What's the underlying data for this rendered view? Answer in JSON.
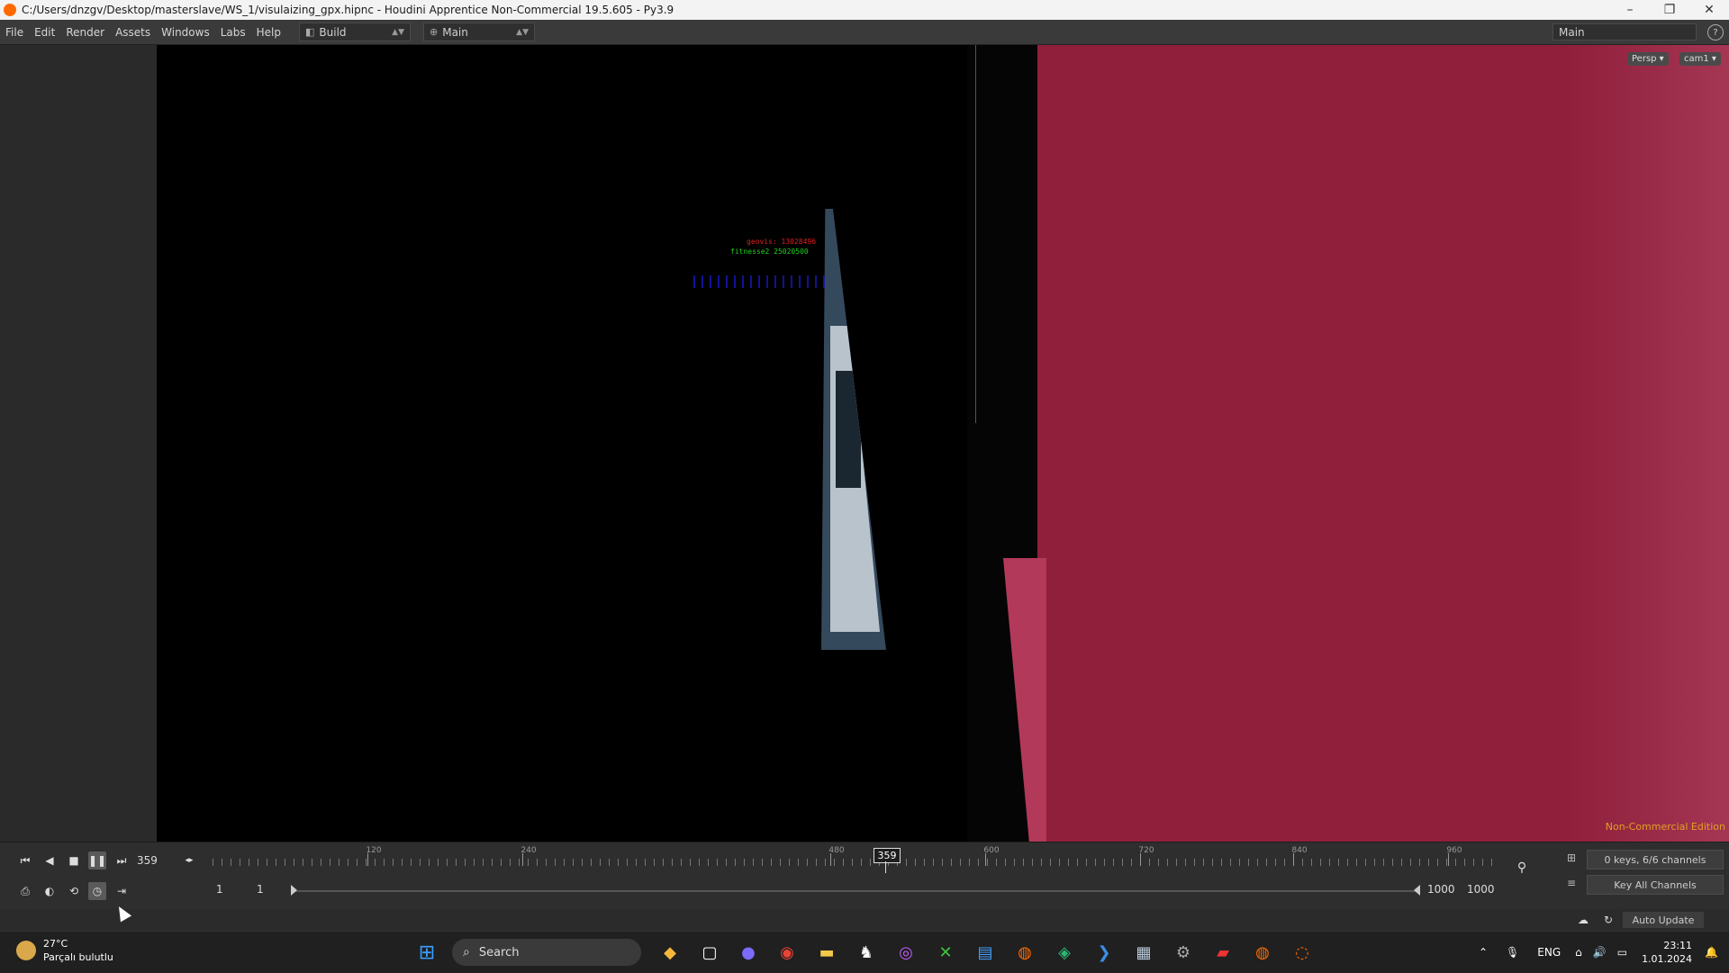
{
  "window": {
    "title": "C:/Users/dnzgv/Desktop/masterslave/WS_1/visulaizing_gpx.hipnc - Houdini Apprentice Non-Commercial 19.5.605 - Py3.9",
    "minimize": "–",
    "maximize": "❐",
    "close": "✕"
  },
  "menubar": {
    "items": [
      "File",
      "Edit",
      "Render",
      "Assets",
      "Windows",
      "Labs",
      "Help"
    ],
    "desktop": "Build",
    "desktop_icon": "◧",
    "workspace": "Main",
    "workspace_icon": "⊕",
    "right_workspace": "Main",
    "help": "?"
  },
  "viewport": {
    "camera_view": "Persp ▾",
    "camera": "cam1 ▾",
    "hud_line1": "geovis: 13028496",
    "hud_line2": "fitnesse2 25020500",
    "watermark": "Non-Commercial Edition"
  },
  "timeline": {
    "current_frame": "359",
    "marker_frame": "359",
    "ruler_labels": [
      "120",
      "240",
      "480",
      "600",
      "720",
      "840",
      "960"
    ],
    "start_frame": "1",
    "start_frame2": "1",
    "end_frame": "1000",
    "end_frame2": "1000",
    "keys_info": "0 keys, 6/6 channels",
    "key_all": "Key All Channels",
    "auto_update": "Auto Update"
  },
  "taskbar": {
    "weather_temp": "27°C",
    "weather_desc": "Parçalı bulutlu",
    "search_label": "Search",
    "language": "ENG",
    "time": "23:11",
    "date": "1.01.2024"
  }
}
